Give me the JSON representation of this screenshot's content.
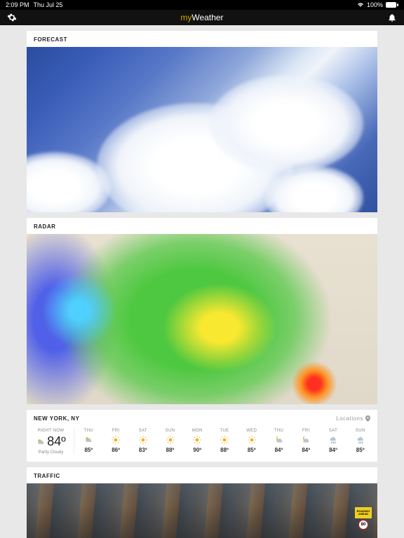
{
  "status": {
    "time": "2:09 PM",
    "date": "Thu Jul 25",
    "battery": "100%"
  },
  "brand": {
    "prefix": "my",
    "suffix": "Weather"
  },
  "forecast_card": {
    "title": "FORECAST"
  },
  "radar_card": {
    "title": "RADAR"
  },
  "traffic_card": {
    "title": "TRAFFIC"
  },
  "sign": {
    "line1": "ROADWO",
    "line2": "AHEAD",
    "speed": "80"
  },
  "location_card": {
    "city": "NEW YORK, NY",
    "locations_label": "Locations",
    "now": {
      "label": "RIGHT NOW",
      "temp": "84º",
      "condition": "Partly Cloudy",
      "icon": "partly-cloudy"
    },
    "days": [
      {
        "label": "THU",
        "temp": "85º",
        "icon": "partly-cloudy"
      },
      {
        "label": "FRI",
        "temp": "86º",
        "icon": "sunny"
      },
      {
        "label": "SAT",
        "temp": "83º",
        "icon": "sunny"
      },
      {
        "label": "SUN",
        "temp": "88º",
        "icon": "sunny"
      },
      {
        "label": "MON",
        "temp": "90º",
        "icon": "sunny"
      },
      {
        "label": "TUE",
        "temp": "88º",
        "icon": "sunny"
      },
      {
        "label": "WED",
        "temp": "85º",
        "icon": "sunny"
      },
      {
        "label": "THU",
        "temp": "84º",
        "icon": "partly-cloudy-night"
      },
      {
        "label": "FRI",
        "temp": "84º",
        "icon": "partly-cloudy-night"
      },
      {
        "label": "SAT",
        "temp": "84º",
        "icon": "rain"
      },
      {
        "label": "SUN",
        "temp": "85º",
        "icon": "rain"
      }
    ]
  }
}
